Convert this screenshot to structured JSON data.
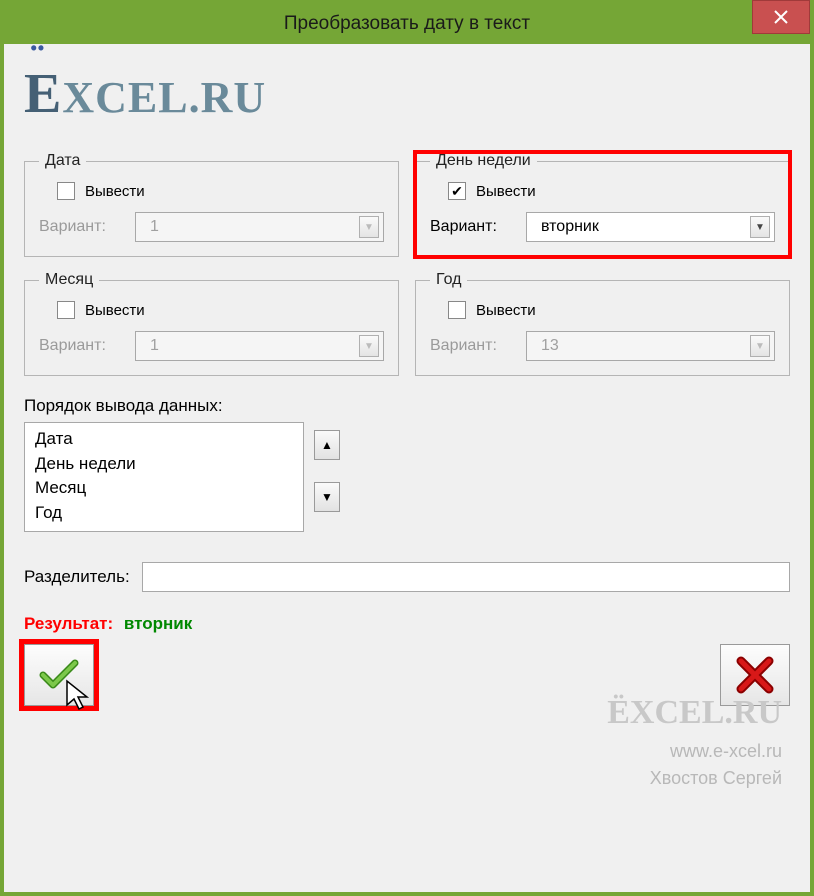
{
  "window": {
    "title": "Преобразовать дату в текст"
  },
  "logo": "XCEL.RU",
  "groups": {
    "date": {
      "legend": "Дата",
      "output": "Вывести",
      "checked": false,
      "variant_label": "Вариант:",
      "variant_value": "1"
    },
    "weekday": {
      "legend": "День недели",
      "output": "Вывести",
      "checked": true,
      "variant_label": "Вариант:",
      "variant_value": "вторник"
    },
    "month": {
      "legend": "Месяц",
      "output": "Вывести",
      "checked": false,
      "variant_label": "Вариант:",
      "variant_value": "1"
    },
    "year": {
      "legend": "Год",
      "output": "Вывести",
      "checked": false,
      "variant_label": "Вариант:",
      "variant_value": "13"
    }
  },
  "order": {
    "label": "Порядок вывода данных:",
    "items": [
      "Дата",
      "День недели",
      "Месяц",
      "Год"
    ]
  },
  "separator": {
    "label": "Разделитель:",
    "value": ""
  },
  "result": {
    "label": "Результат:",
    "value": "вторник"
  },
  "watermark": {
    "logo": "ËXCEL.RU",
    "url": "www.e-xcel.ru",
    "author": "Хвостов Сергей"
  }
}
